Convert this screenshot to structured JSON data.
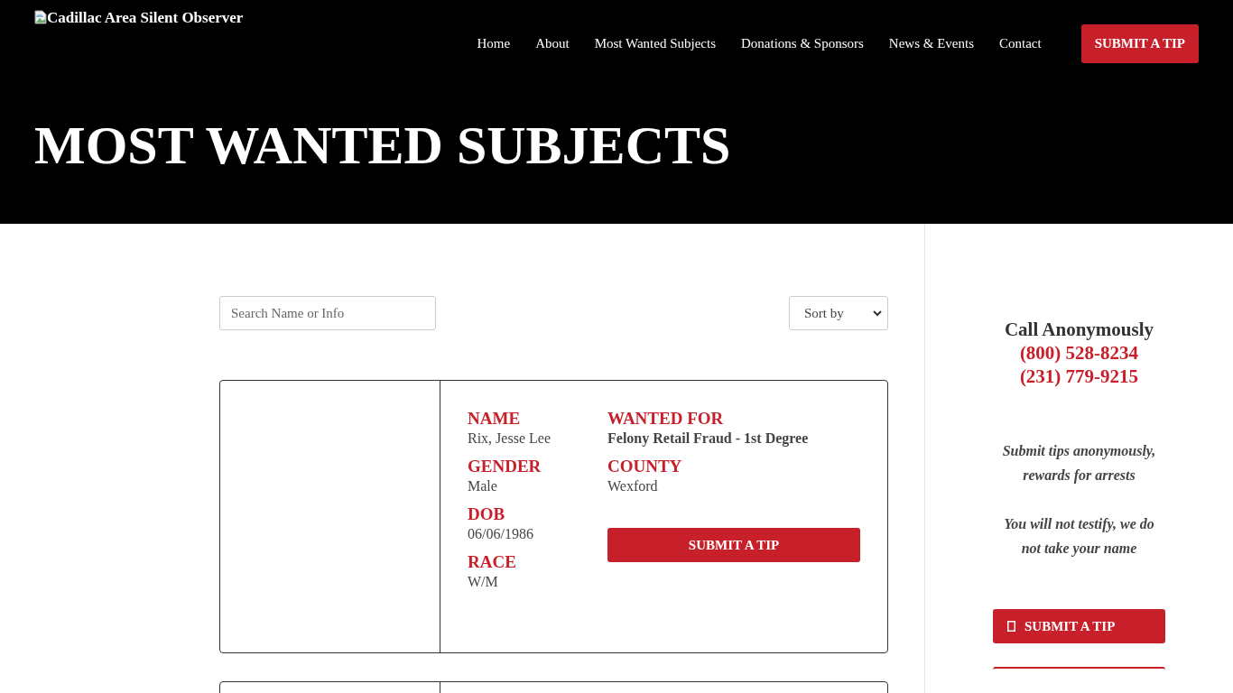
{
  "header": {
    "logo_alt": "Cadillac Area Silent Observer",
    "nav": [
      {
        "label": "Home"
      },
      {
        "label": "About"
      },
      {
        "label": "Most Wanted Subjects"
      },
      {
        "label": "Donations & Sponsors"
      },
      {
        "label": "News & Events"
      },
      {
        "label": "Contact"
      }
    ],
    "cta": "SUBMIT A TIP"
  },
  "hero_title": "MOST WANTED SUBJECTS",
  "search": {
    "placeholder": "Search Name or Info"
  },
  "sort": {
    "value": "Sort by"
  },
  "subjects": [
    {
      "kind": "full",
      "left": [
        {
          "label": "NAME",
          "value": "Rix, Jesse Lee"
        },
        {
          "label": "GENDER",
          "value": "Male"
        },
        {
          "label": "DOB",
          "value": "06/06/1986"
        },
        {
          "label": "RACE",
          "value": "W/M"
        }
      ],
      "right": [
        {
          "label": "WANTED FOR",
          "value": "Felony Retail Fraud - 1st Degree",
          "bold": true
        },
        {
          "label": "COUNTY",
          "value": "Wexford",
          "bold": false
        }
      ],
      "button": "SUBMIT A TIP"
    },
    {
      "kind": "partial"
    }
  ],
  "sidebar": {
    "title": "Call Anonymously",
    "phones": [
      "(800) 528-8234",
      "(231) 779-9215"
    ],
    "notes": [
      "Submit tips anonymously, rewards for arrests",
      "You will not testify, we do not take your name"
    ],
    "button": "SUBMIT A TIP"
  }
}
